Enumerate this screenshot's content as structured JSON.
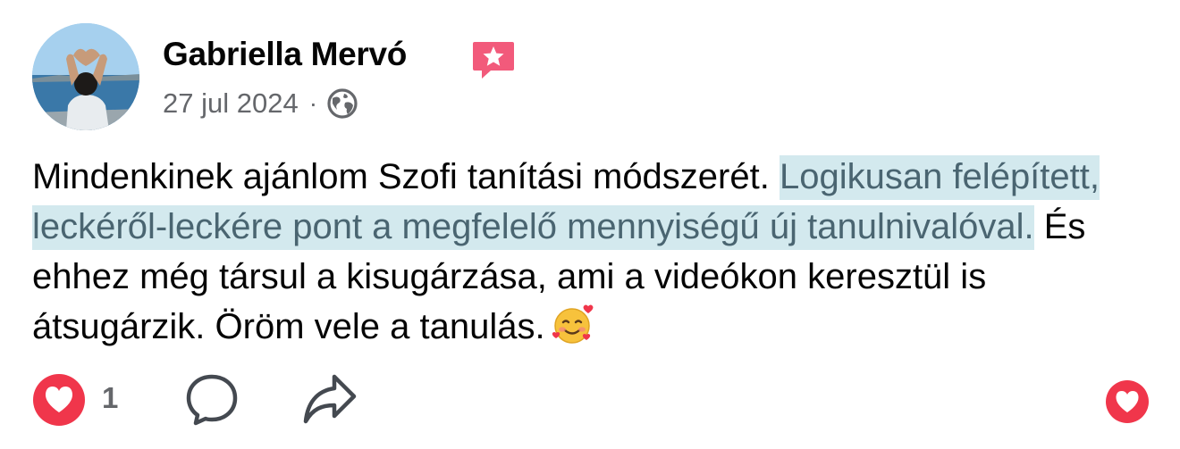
{
  "post": {
    "author_name": "Gabriella Mervó",
    "date": "27 jul 2024",
    "separator": "·",
    "audience_icon": "globe-icon",
    "badge_icon": "star-badge-icon",
    "text_before": "Mindenkinek ajánlom Szofi tanítási módszerét.",
    "text_highlighted": "Logikusan felépített, leckéről-leckére pont a megfelelő mennyiségű új tanulnivalóval.",
    "text_after": "És ehhez még társul a kisugárzása, ami a videókon keresztül is átsugárzik. Öröm vele a tanulás.",
    "emoji": "smiling-face-with-hearts"
  },
  "actions": {
    "like_count": "1",
    "like_icon": "heart-icon",
    "comment_icon": "comment-icon",
    "share_icon": "share-icon",
    "react_icon": "heart-icon"
  },
  "colors": {
    "heart_red": "#f0364b",
    "highlight_bg": "#d3e9ee",
    "highlight_text": "#4a6571",
    "badge_pink": "#f25a7b",
    "meta_gray": "#65676b"
  }
}
